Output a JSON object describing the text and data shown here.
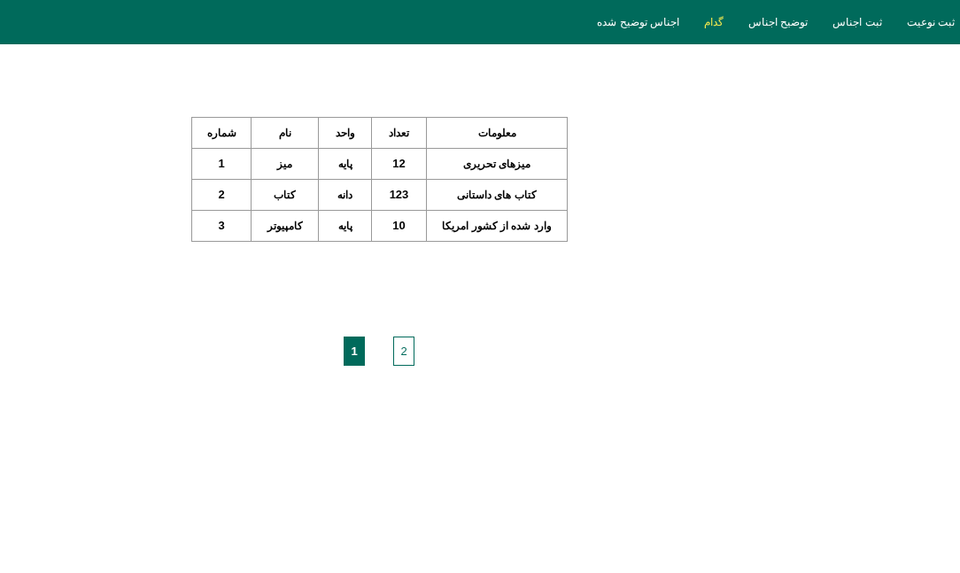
{
  "nav": [
    {
      "label": "ثبت نوعیت",
      "selected": false
    },
    {
      "label": "ثبت اجناس",
      "selected": false
    },
    {
      "label": "توضیح اجناس",
      "selected": false
    },
    {
      "label": "گدام",
      "selected": true
    },
    {
      "label": "اجناس توضیح شده",
      "selected": false
    }
  ],
  "table": {
    "columns": [
      "معلومات",
      "تعداد",
      "واحد",
      "نام",
      "شماره"
    ],
    "rows": [
      [
        "میزهای تحریری",
        "12",
        "پایه",
        "میز",
        "1"
      ],
      [
        "کتاب های داستانی",
        "123",
        "دانه",
        "کتاب",
        "2"
      ],
      [
        "وارد شده از کشور امریکا",
        "10",
        "پایه",
        "کامپیوتر",
        "3"
      ]
    ]
  },
  "pagination": [
    {
      "label": "2",
      "selected": false
    },
    {
      "label": "1",
      "selected": true
    }
  ]
}
